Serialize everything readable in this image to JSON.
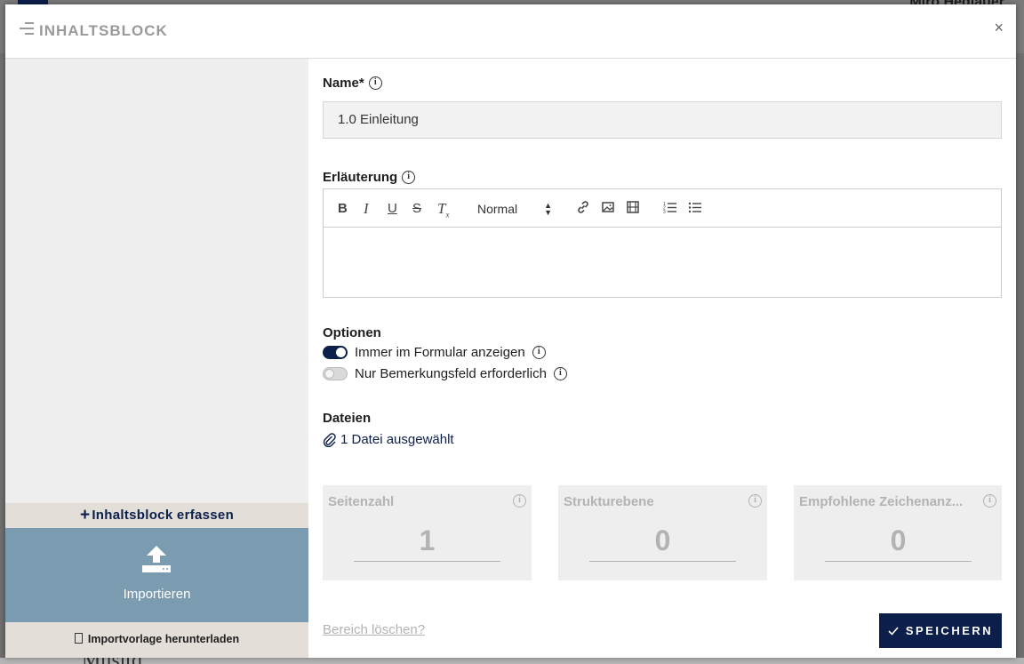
{
  "background": {
    "user_name": "Miro Hediauer",
    "brand_text": "Musitd"
  },
  "modal": {
    "title": "INHALTSBLOCK",
    "close_label": "×"
  },
  "left_panel": {
    "add_block_label": "Inhaltsblock erfassen",
    "import_label": "Importieren",
    "download_template_label": "Importvorlage herunterladen"
  },
  "form": {
    "name_label": "Name*",
    "name_value": "1.0 Einleitung",
    "description_label": "Erläuterung",
    "editor": {
      "format_select": "Normal"
    },
    "options_label": "Optionen",
    "options": [
      {
        "label": "Immer im Formular anzeigen",
        "enabled": true
      },
      {
        "label": "Nur Bemerkungsfeld erforderlich",
        "enabled": false
      }
    ],
    "files_label": "Dateien",
    "files_link": "1 Datei ausgewählt",
    "cards": [
      {
        "title": "Seitenzahl",
        "value": "1"
      },
      {
        "title": "Strukturebene",
        "value": "0"
      },
      {
        "title": "Empfohlene Zeichenanz...",
        "value": "0"
      }
    ],
    "delete_label": "Bereich löschen?",
    "save_label": "SPEICHERN"
  },
  "colors": {
    "primary": "#0b1f4a",
    "import_bg": "#7b9bb0",
    "panel_bg": "#eeeeee",
    "accent_bar": "#e3dfd8"
  }
}
